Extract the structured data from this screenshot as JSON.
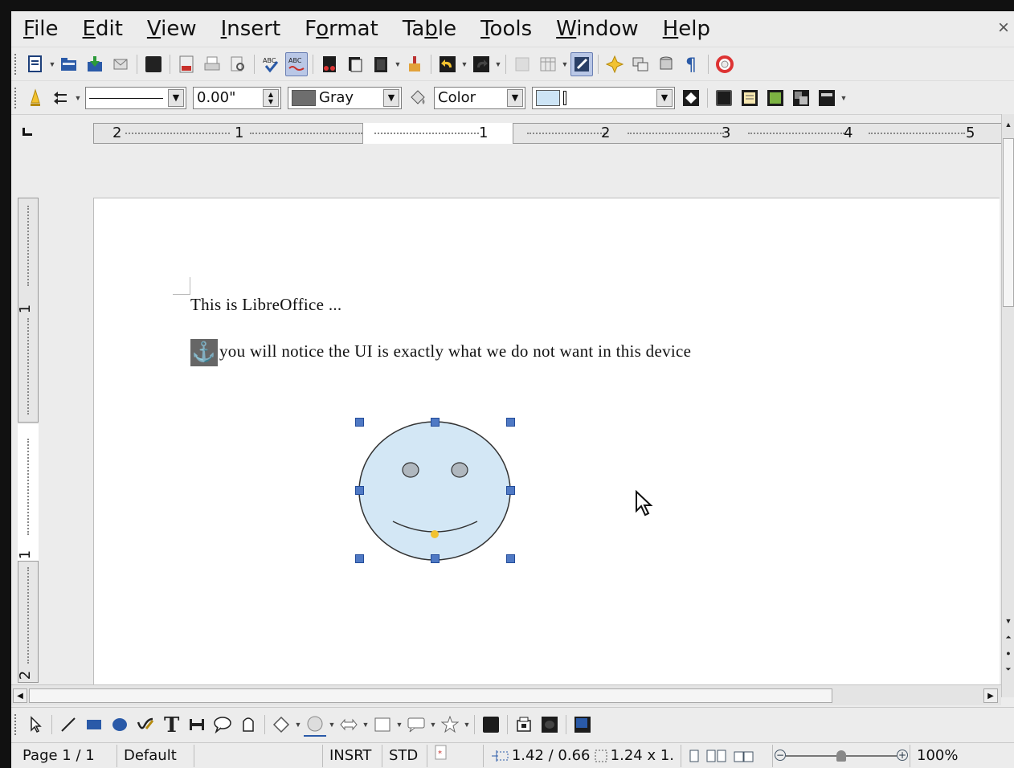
{
  "menu": {
    "items": [
      {
        "label": "File",
        "key": "F",
        "rest": "ile"
      },
      {
        "label": "Edit",
        "key": "E",
        "rest": "dit"
      },
      {
        "label": "View",
        "key": "V",
        "rest": "iew"
      },
      {
        "label": "Insert",
        "key": "I",
        "rest": "nsert"
      },
      {
        "label": "Format",
        "pre": "F",
        "key": "o",
        "rest": "rmat"
      },
      {
        "label": "Table",
        "pre": "Ta",
        "key": "b",
        "rest": "le"
      },
      {
        "label": "Tools",
        "key": "T",
        "rest": "ools"
      },
      {
        "label": "Window",
        "key": "W",
        "rest": "indow"
      },
      {
        "label": "Help",
        "key": "H",
        "rest": "elp"
      }
    ],
    "close_symbol": "×"
  },
  "format_toolbar": {
    "line_width": "0.00\"",
    "line_color": "Gray",
    "line_color_hex": "#6e6e6e",
    "area_style": "Color",
    "area_color_hex": "#cde4f5"
  },
  "ruler": {
    "h_labels": [
      "2",
      "1",
      "1",
      "2",
      "3",
      "4",
      "5"
    ],
    "v_labels": [
      "1",
      "1",
      "2"
    ]
  },
  "document": {
    "line1": "This is LibreOffice ...",
    "anchor_symbol": "⚓",
    "line2": "you will notice the UI is exactly what we do not want in this device"
  },
  "drawing": {
    "shape": "smiley",
    "fill_hex": "#d3e7f5",
    "stroke_hex": "#333333",
    "eye_fill_hex": "#b0b8bf",
    "handle_hex": "#4f79c4",
    "adjust_handle_hex": "#f2c230"
  },
  "statusbar": {
    "page": "Page 1 / 1",
    "style": "Default",
    "insert_mode": "INSRT",
    "selection_mode": "STD",
    "position": "1.42 / 0.66",
    "size": "1.24 x 1.",
    "zoom": "100%",
    "zoom_level": 0.5
  },
  "colors": {
    "chrome": "#ececec",
    "accent": "#4f79c4"
  }
}
